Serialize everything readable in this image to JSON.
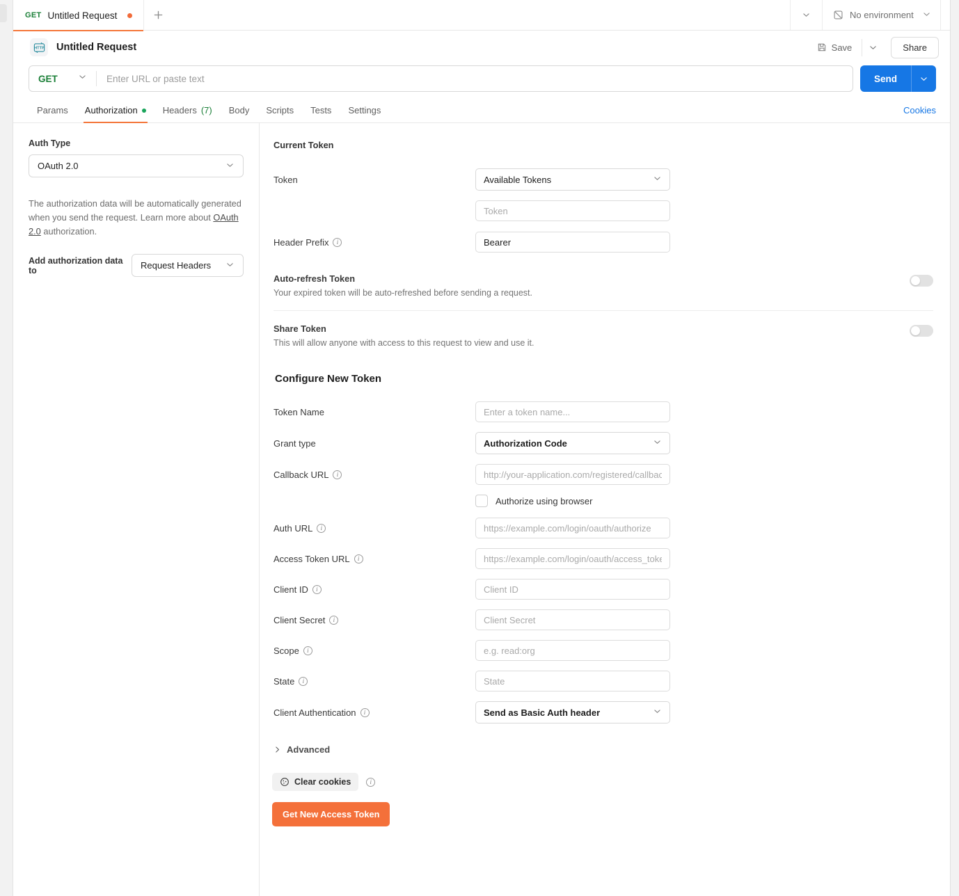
{
  "window": {
    "tab": {
      "method": "GET",
      "title": "Untitled Request",
      "dirty_indicator": "unsaved-dot",
      "new_tab_icon": "plus-icon",
      "overflow_icon": "chevron-down-icon"
    },
    "environment": {
      "icon": "no-environment-icon",
      "label": "No environment",
      "caret_icon": "chevron-down-icon"
    }
  },
  "request_header": {
    "icon": "http-icon",
    "title": "Untitled Request",
    "save_label": "Save",
    "save_icon": "floppy-disk-icon",
    "save_caret_icon": "chevron-down-icon",
    "share_label": "Share"
  },
  "url_bar": {
    "method": "GET",
    "method_caret_icon": "chevron-down-icon",
    "url_value": "",
    "url_placeholder": "Enter URL or paste text",
    "send_label": "Send",
    "send_caret_icon": "chevron-down-icon",
    "send_color": "#1677e5"
  },
  "tabs": {
    "items": [
      {
        "label": "Params",
        "active": false
      },
      {
        "label": "Authorization",
        "active": true,
        "dot": true
      },
      {
        "label": "Headers",
        "count": "(7)",
        "active": false
      },
      {
        "label": "Body",
        "active": false
      },
      {
        "label": "Scripts",
        "active": false
      },
      {
        "label": "Tests",
        "active": false
      },
      {
        "label": "Settings",
        "active": false
      }
    ],
    "cookies_link": "Cookies",
    "active_underline_color": "#f4763a",
    "dot_color": "#19a45a"
  },
  "left_pane": {
    "auth_type_label": "Auth Type",
    "auth_type_value": "OAuth 2.0",
    "auth_type_caret_icon": "chevron-down-icon",
    "helper_text_1": "The authorization data will be automatically generated when you send the request. Learn more about ",
    "helper_link": "OAuth 2.0",
    "helper_text_2": " authorization.",
    "add_data_label": "Add authorization data to",
    "add_data_value": "Request Headers",
    "add_data_caret_icon": "chevron-down-icon"
  },
  "current_token": {
    "heading": "Current Token",
    "token_label": "Token",
    "token_select_value": "Available Tokens",
    "token_select_caret_icon": "chevron-down-icon",
    "token_input_value": "",
    "token_input_placeholder": "Token",
    "header_prefix_label": "Header Prefix",
    "header_prefix_info_icon": "info-icon",
    "header_prefix_value": "Bearer",
    "auto_refresh_title": "Auto-refresh Token",
    "auto_refresh_desc": "Your expired token will be auto-refreshed before sending a request.",
    "auto_refresh_state": "off",
    "share_token_title": "Share Token",
    "share_token_desc": "This will allow anyone with access to this request to view and use it.",
    "share_token_state": "off"
  },
  "configure_new_token": {
    "heading": "Configure New Token",
    "fields": [
      {
        "label": "Token Name",
        "info": false,
        "type": "input",
        "value": "",
        "placeholder": "Enter a token name..."
      },
      {
        "label": "Grant type",
        "info": false,
        "type": "select",
        "value": "Authorization Code"
      },
      {
        "label": "Callback URL",
        "info": true,
        "type": "input",
        "value": "",
        "placeholder": "http://your-application.com/registered/callback/url"
      },
      {
        "label": "Auth URL",
        "info": true,
        "type": "input",
        "value": "",
        "placeholder": "https://example.com/login/oauth/authorize"
      },
      {
        "label": "Access Token URL",
        "info": true,
        "type": "input",
        "value": "",
        "placeholder": "https://example.com/login/oauth/access_token"
      },
      {
        "label": "Client ID",
        "info": true,
        "type": "input",
        "value": "",
        "placeholder": "Client ID"
      },
      {
        "label": "Client Secret",
        "info": true,
        "type": "input",
        "value": "",
        "placeholder": "Client Secret"
      },
      {
        "label": "Scope",
        "info": true,
        "type": "input",
        "value": "",
        "placeholder": "e.g. read:org"
      },
      {
        "label": "State",
        "info": true,
        "type": "input",
        "value": "",
        "placeholder": "State"
      },
      {
        "label": "Client Authentication",
        "info": true,
        "type": "select",
        "value": "Send as Basic Auth header"
      }
    ],
    "authorize_browser_label": "Authorize using browser",
    "authorize_browser_checked": false,
    "advanced_label": "Advanced",
    "advanced_icon": "chevron-right-icon",
    "clear_cookies_label": "Clear cookies",
    "clear_cookies_icon": "cookie-icon",
    "clear_cookies_info_icon": "info-icon",
    "get_token_label": "Get New Access Token",
    "get_token_color": "#f4703a"
  }
}
